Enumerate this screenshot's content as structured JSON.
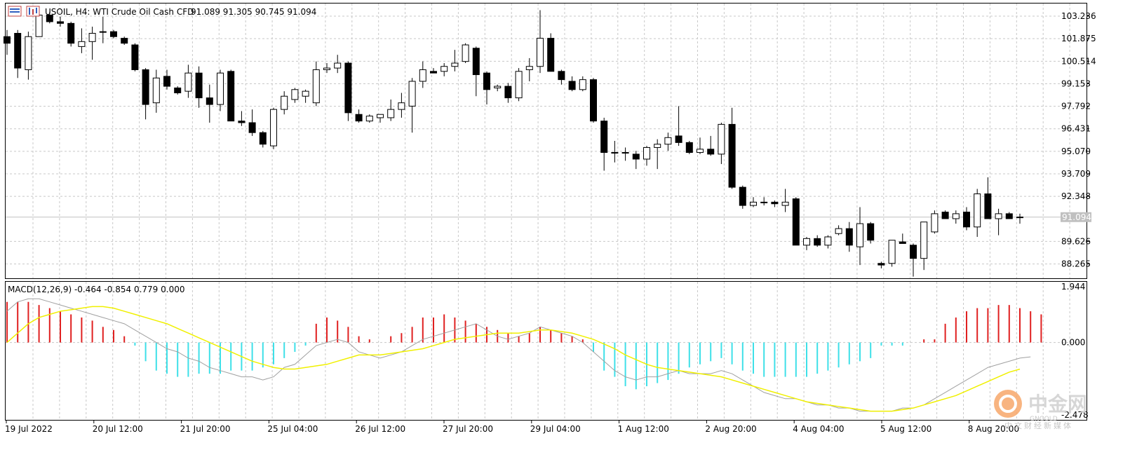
{
  "header": {
    "symbol_line": "USOIL, H4:  WTI Crude Oil Cash CFD",
    "ohlc_line": "91.089 91.305 90.745 91.094"
  },
  "macd_header": "MACD(12,26,9) -0.464 -0.854 0.779 0.000",
  "price_axis": [
    "103.236",
    "101.875",
    "100.514",
    "99.153",
    "97.792",
    "96.431",
    "95.070",
    "93.709",
    "92.348",
    "89.626",
    "88.265"
  ],
  "current_price_label": "91.094",
  "macd_axis": [
    "1.944",
    "0.000",
    "-2.478"
  ],
  "time_axis": [
    "19 Jul 2022",
    "20 Jul 12:00",
    "21 Jul 20:00",
    "25 Jul 04:00",
    "26 Jul 12:00",
    "27 Jul 20:00",
    "29 Jul 04:00",
    "1 Aug 12:00",
    "2 Aug 20:00",
    "4 Aug 04:00",
    "5 Aug 12:00",
    "8 Aug 20:00"
  ],
  "watermark": {
    "name": "中金网",
    "sub": "GNGOLD",
    "tagline": "中文财经新媒体"
  },
  "colors": {
    "bull_fill": "#ffffff",
    "bear_fill": "#000000",
    "hist_pos": "#e02020",
    "hist_neg": "#3ee0e8",
    "signal": "#f0f000",
    "macd_line": "#a0a0a0",
    "grid": "#c8c8c8"
  },
  "chart_data": [
    {
      "type": "candlestick",
      "title": "USOIL, H4: WTI Crude Oil Cash CFD",
      "ylim": [
        87.4,
        104.0
      ],
      "y_ticks": [
        103.236,
        101.875,
        100.514,
        99.153,
        97.792,
        96.431,
        95.07,
        93.709,
        92.348,
        89.626,
        88.265
      ],
      "last_price": 91.094,
      "candles": [
        {
          "o": 102.0,
          "h": 102.4,
          "l": 100.9,
          "c": 101.6
        },
        {
          "o": 102.2,
          "h": 102.4,
          "l": 99.5,
          "c": 100.1
        },
        {
          "o": 100.0,
          "h": 102.3,
          "l": 99.4,
          "c": 102.0
        },
        {
          "o": 102.0,
          "h": 103.5,
          "l": 102.0,
          "c": 103.3
        },
        {
          "o": 103.3,
          "h": 103.5,
          "l": 102.8,
          "c": 102.9
        },
        {
          "o": 102.9,
          "h": 103.2,
          "l": 102.6,
          "c": 102.8
        },
        {
          "o": 102.8,
          "h": 102.9,
          "l": 101.4,
          "c": 101.6
        },
        {
          "o": 101.4,
          "h": 102.5,
          "l": 101.0,
          "c": 101.7
        },
        {
          "o": 101.7,
          "h": 102.6,
          "l": 100.6,
          "c": 102.2
        },
        {
          "o": 102.3,
          "h": 103.2,
          "l": 101.6,
          "c": 102.3
        },
        {
          "o": 102.3,
          "h": 102.4,
          "l": 101.9,
          "c": 102.0
        },
        {
          "o": 101.9,
          "h": 102.0,
          "l": 101.5,
          "c": 101.6
        },
        {
          "o": 101.5,
          "h": 101.6,
          "l": 99.9,
          "c": 100.0
        },
        {
          "o": 100.0,
          "h": 100.1,
          "l": 97.0,
          "c": 97.9
        },
        {
          "o": 98.0,
          "h": 100.0,
          "l": 97.4,
          "c": 99.5
        },
        {
          "o": 99.6,
          "h": 100.0,
          "l": 98.8,
          "c": 99.0
        },
        {
          "o": 98.9,
          "h": 99.0,
          "l": 98.5,
          "c": 98.6
        },
        {
          "o": 98.7,
          "h": 100.3,
          "l": 98.3,
          "c": 99.8
        },
        {
          "o": 99.8,
          "h": 100.2,
          "l": 97.7,
          "c": 98.3
        },
        {
          "o": 98.3,
          "h": 99.1,
          "l": 96.8,
          "c": 97.9
        },
        {
          "o": 97.9,
          "h": 100.0,
          "l": 97.5,
          "c": 99.8
        },
        {
          "o": 99.9,
          "h": 100.0,
          "l": 96.9,
          "c": 96.9
        },
        {
          "o": 96.9,
          "h": 97.5,
          "l": 96.6,
          "c": 96.8
        },
        {
          "o": 96.8,
          "h": 97.6,
          "l": 96.0,
          "c": 96.2
        },
        {
          "o": 96.2,
          "h": 96.3,
          "l": 95.3,
          "c": 95.5
        },
        {
          "o": 95.4,
          "h": 97.7,
          "l": 95.2,
          "c": 97.6
        },
        {
          "o": 97.6,
          "h": 98.7,
          "l": 97.3,
          "c": 98.4
        },
        {
          "o": 98.2,
          "h": 98.9,
          "l": 98.0,
          "c": 98.8
        },
        {
          "o": 98.4,
          "h": 98.8,
          "l": 98.0,
          "c": 98.7
        },
        {
          "o": 98.0,
          "h": 100.5,
          "l": 97.8,
          "c": 100.0
        },
        {
          "o": 100.0,
          "h": 100.4,
          "l": 99.8,
          "c": 100.1
        },
        {
          "o": 100.1,
          "h": 100.9,
          "l": 99.8,
          "c": 100.4
        },
        {
          "o": 100.4,
          "h": 100.5,
          "l": 96.9,
          "c": 97.4
        },
        {
          "o": 97.3,
          "h": 97.6,
          "l": 96.8,
          "c": 96.9
        },
        {
          "o": 96.9,
          "h": 97.3,
          "l": 96.8,
          "c": 97.2
        },
        {
          "o": 97.1,
          "h": 97.3,
          "l": 96.8,
          "c": 97.3
        },
        {
          "o": 97.1,
          "h": 98.2,
          "l": 96.9,
          "c": 97.6
        },
        {
          "o": 97.6,
          "h": 98.6,
          "l": 97.1,
          "c": 98.0
        },
        {
          "o": 97.8,
          "h": 99.5,
          "l": 96.2,
          "c": 99.3
        },
        {
          "o": 99.3,
          "h": 100.5,
          "l": 98.9,
          "c": 100.0
        },
        {
          "o": 99.9,
          "h": 100.1,
          "l": 99.8,
          "c": 99.8
        },
        {
          "o": 99.9,
          "h": 100.4,
          "l": 99.6,
          "c": 100.2
        },
        {
          "o": 100.2,
          "h": 101.2,
          "l": 99.9,
          "c": 100.4
        },
        {
          "o": 100.5,
          "h": 101.6,
          "l": 100.4,
          "c": 101.5
        },
        {
          "o": 101.3,
          "h": 101.4,
          "l": 98.4,
          "c": 99.7
        },
        {
          "o": 99.8,
          "h": 99.9,
          "l": 97.9,
          "c": 98.8
        },
        {
          "o": 98.9,
          "h": 99.1,
          "l": 98.7,
          "c": 99.0
        },
        {
          "o": 99.0,
          "h": 99.2,
          "l": 98.0,
          "c": 98.3
        },
        {
          "o": 98.3,
          "h": 100.1,
          "l": 98.1,
          "c": 99.9
        },
        {
          "o": 100.0,
          "h": 100.7,
          "l": 99.3,
          "c": 100.2
        },
        {
          "o": 100.2,
          "h": 103.6,
          "l": 99.8,
          "c": 101.9
        },
        {
          "o": 101.9,
          "h": 102.2,
          "l": 99.9,
          "c": 99.9
        },
        {
          "o": 99.9,
          "h": 100.0,
          "l": 99.1,
          "c": 99.4
        },
        {
          "o": 99.3,
          "h": 99.6,
          "l": 98.7,
          "c": 98.8
        },
        {
          "o": 98.8,
          "h": 99.6,
          "l": 98.7,
          "c": 99.4
        },
        {
          "o": 99.4,
          "h": 99.5,
          "l": 96.8,
          "c": 96.9
        },
        {
          "o": 96.9,
          "h": 97.1,
          "l": 93.9,
          "c": 95.0
        },
        {
          "o": 95.0,
          "h": 95.7,
          "l": 94.4,
          "c": 95.0
        },
        {
          "o": 95.0,
          "h": 95.3,
          "l": 94.5,
          "c": 95.0
        },
        {
          "o": 94.9,
          "h": 95.1,
          "l": 94.0,
          "c": 94.6
        },
        {
          "o": 94.6,
          "h": 95.4,
          "l": 94.2,
          "c": 95.3
        },
        {
          "o": 95.3,
          "h": 95.8,
          "l": 94.0,
          "c": 95.5
        },
        {
          "o": 95.5,
          "h": 96.2,
          "l": 95.1,
          "c": 95.9
        },
        {
          "o": 96.0,
          "h": 97.8,
          "l": 95.4,
          "c": 95.6
        },
        {
          "o": 95.6,
          "h": 95.7,
          "l": 94.9,
          "c": 95.0
        },
        {
          "o": 95.0,
          "h": 95.9,
          "l": 94.9,
          "c": 95.2
        },
        {
          "o": 95.2,
          "h": 96.0,
          "l": 94.8,
          "c": 94.9
        },
        {
          "o": 94.9,
          "h": 96.8,
          "l": 94.3,
          "c": 96.7
        },
        {
          "o": 96.7,
          "h": 97.7,
          "l": 92.8,
          "c": 92.9
        },
        {
          "o": 92.9,
          "h": 93.0,
          "l": 91.6,
          "c": 91.8
        },
        {
          "o": 91.8,
          "h": 92.3,
          "l": 91.7,
          "c": 92.0
        },
        {
          "o": 92.0,
          "h": 92.3,
          "l": 91.8,
          "c": 92.0
        },
        {
          "o": 92.0,
          "h": 92.1,
          "l": 91.7,
          "c": 91.9
        },
        {
          "o": 91.8,
          "h": 92.8,
          "l": 91.4,
          "c": 92.0
        },
        {
          "o": 92.2,
          "h": 92.3,
          "l": 89.4,
          "c": 89.4
        },
        {
          "o": 89.4,
          "h": 89.9,
          "l": 89.1,
          "c": 89.8
        },
        {
          "o": 89.8,
          "h": 90.0,
          "l": 89.3,
          "c": 89.4
        },
        {
          "o": 89.4,
          "h": 90.0,
          "l": 89.2,
          "c": 89.9
        },
        {
          "o": 90.1,
          "h": 90.6,
          "l": 90.0,
          "c": 90.4
        },
        {
          "o": 90.4,
          "h": 90.8,
          "l": 89.0,
          "c": 89.4
        },
        {
          "o": 89.3,
          "h": 91.7,
          "l": 88.2,
          "c": 90.7
        },
        {
          "o": 90.7,
          "h": 90.8,
          "l": 89.5,
          "c": 89.7
        },
        {
          "o": 88.3,
          "h": 88.4,
          "l": 88.0,
          "c": 88.2
        },
        {
          "o": 88.3,
          "h": 89.7,
          "l": 88.1,
          "c": 89.7
        },
        {
          "o": 89.6,
          "h": 90.1,
          "l": 89.5,
          "c": 89.5
        },
        {
          "o": 89.4,
          "h": 89.5,
          "l": 87.5,
          "c": 88.6
        },
        {
          "o": 88.6,
          "h": 90.4,
          "l": 87.9,
          "c": 90.8
        },
        {
          "o": 90.2,
          "h": 91.5,
          "l": 90.1,
          "c": 91.3
        },
        {
          "o": 91.4,
          "h": 91.5,
          "l": 91.0,
          "c": 91.0
        },
        {
          "o": 91.0,
          "h": 91.5,
          "l": 90.7,
          "c": 91.3
        },
        {
          "o": 91.4,
          "h": 91.7,
          "l": 90.3,
          "c": 90.5
        },
        {
          "o": 90.5,
          "h": 92.8,
          "l": 89.9,
          "c": 92.5
        },
        {
          "o": 92.5,
          "h": 93.5,
          "l": 91.0,
          "c": 91.0
        },
        {
          "o": 91.0,
          "h": 91.6,
          "l": 90.0,
          "c": 91.3
        },
        {
          "o": 91.3,
          "h": 91.4,
          "l": 91.0,
          "c": 91.0
        },
        {
          "o": 91.1,
          "h": 91.3,
          "l": 90.7,
          "c": 91.1
        }
      ]
    },
    {
      "type": "histogram",
      "title": "MACD(12,26,9)",
      "ylim": [
        -2.478,
        1.944
      ],
      "macd": -0.464,
      "signal": -0.854,
      "histogram": [
        1.3,
        1.3,
        1.3,
        1.2,
        1.1,
        1.0,
        0.9,
        0.8,
        0.7,
        0.5,
        0.4,
        0.2,
        -0.1,
        -0.6,
        -0.9,
        -1.0,
        -1.1,
        -1.1,
        -1.0,
        -1.0,
        -1.0,
        -0.9,
        -0.9,
        -0.9,
        -0.8,
        -0.7,
        -0.5,
        -0.3,
        -0.1,
        0.6,
        0.8,
        0.7,
        0.5,
        0.2,
        0.1,
        0.0,
        0.2,
        0.3,
        0.5,
        0.8,
        0.8,
        0.9,
        0.8,
        0.7,
        0.6,
        0.5,
        0.4,
        0.3,
        0.2,
        0.3,
        0.5,
        0.4,
        0.3,
        0.2,
        0.1,
        -0.3,
        -0.9,
        -1.1,
        -1.4,
        -1.5,
        -1.4,
        -1.3,
        -1.2,
        -1.0,
        -0.8,
        -0.7,
        -0.6,
        -0.5,
        -0.7,
        -0.9,
        -1.0,
        -1.1,
        -1.1,
        -1.1,
        -1.1,
        -1.1,
        -1.0,
        -0.9,
        -0.8,
        -0.7,
        -0.6,
        -0.5,
        -0.1,
        -0.1,
        -0.1,
        0.0,
        0.1,
        0.1,
        0.6,
        0.8,
        1.0,
        1.1,
        1.1,
        1.2,
        1.2,
        1.1,
        1.0,
        0.9
      ],
      "macd_line": [
        1.0,
        1.3,
        1.4,
        1.4,
        1.3,
        1.2,
        1.1,
        1.0,
        0.9,
        0.8,
        0.7,
        0.6,
        0.4,
        0.2,
        0.0,
        -0.2,
        -0.3,
        -0.5,
        -0.6,
        -0.8,
        -0.9,
        -1.0,
        -1.1,
        -1.1,
        -1.2,
        -1.1,
        -0.8,
        -0.7,
        -0.4,
        -0.1,
        0.0,
        0.1,
        0.0,
        -0.3,
        -0.4,
        -0.5,
        -0.4,
        -0.3,
        -0.1,
        0.1,
        0.2,
        0.3,
        0.4,
        0.5,
        0.6,
        0.4,
        0.2,
        0.1,
        0.2,
        0.3,
        0.5,
        0.4,
        0.3,
        0.2,
        0.0,
        -0.3,
        -0.6,
        -0.9,
        -1.1,
        -1.2,
        -1.1,
        -1.1,
        -1.0,
        -0.9,
        -1.0,
        -1.0,
        -1.0,
        -0.9,
        -1.0,
        -1.2,
        -1.4,
        -1.6,
        -1.7,
        -1.8,
        -1.8,
        -1.9,
        -2.0,
        -2.0,
        -2.1,
        -2.1,
        -2.2,
        -2.2,
        -2.2,
        -2.2,
        -2.1,
        -2.1,
        -2.0,
        -1.8,
        -1.6,
        -1.4,
        -1.2,
        -1.0,
        -0.8,
        -0.7,
        -0.6,
        -0.5,
        -0.46
      ],
      "signal_line": [
        0.0,
        0.3,
        0.6,
        0.8,
        0.9,
        1.0,
        1.05,
        1.1,
        1.15,
        1.15,
        1.1,
        1.0,
        0.9,
        0.8,
        0.7,
        0.6,
        0.45,
        0.3,
        0.15,
        0.0,
        -0.15,
        -0.3,
        -0.45,
        -0.6,
        -0.7,
        -0.8,
        -0.85,
        -0.85,
        -0.8,
        -0.75,
        -0.7,
        -0.6,
        -0.5,
        -0.4,
        -0.4,
        -0.4,
        -0.35,
        -0.3,
        -0.25,
        -0.2,
        -0.1,
        0.0,
        0.1,
        0.15,
        0.2,
        0.25,
        0.3,
        0.3,
        0.3,
        0.35,
        0.4,
        0.4,
        0.35,
        0.3,
        0.2,
        0.1,
        -0.05,
        -0.2,
        -0.4,
        -0.55,
        -0.7,
        -0.8,
        -0.85,
        -0.9,
        -0.95,
        -1.0,
        -1.05,
        -1.1,
        -1.2,
        -1.3,
        -1.4,
        -1.5,
        -1.6,
        -1.7,
        -1.8,
        -1.9,
        -1.95,
        -2.0,
        -2.05,
        -2.1,
        -2.15,
        -2.2,
        -2.2,
        -2.2,
        -2.15,
        -2.1,
        -2.0,
        -1.9,
        -1.8,
        -1.7,
        -1.55,
        -1.4,
        -1.25,
        -1.1,
        -0.95,
        -0.854
      ]
    }
  ]
}
